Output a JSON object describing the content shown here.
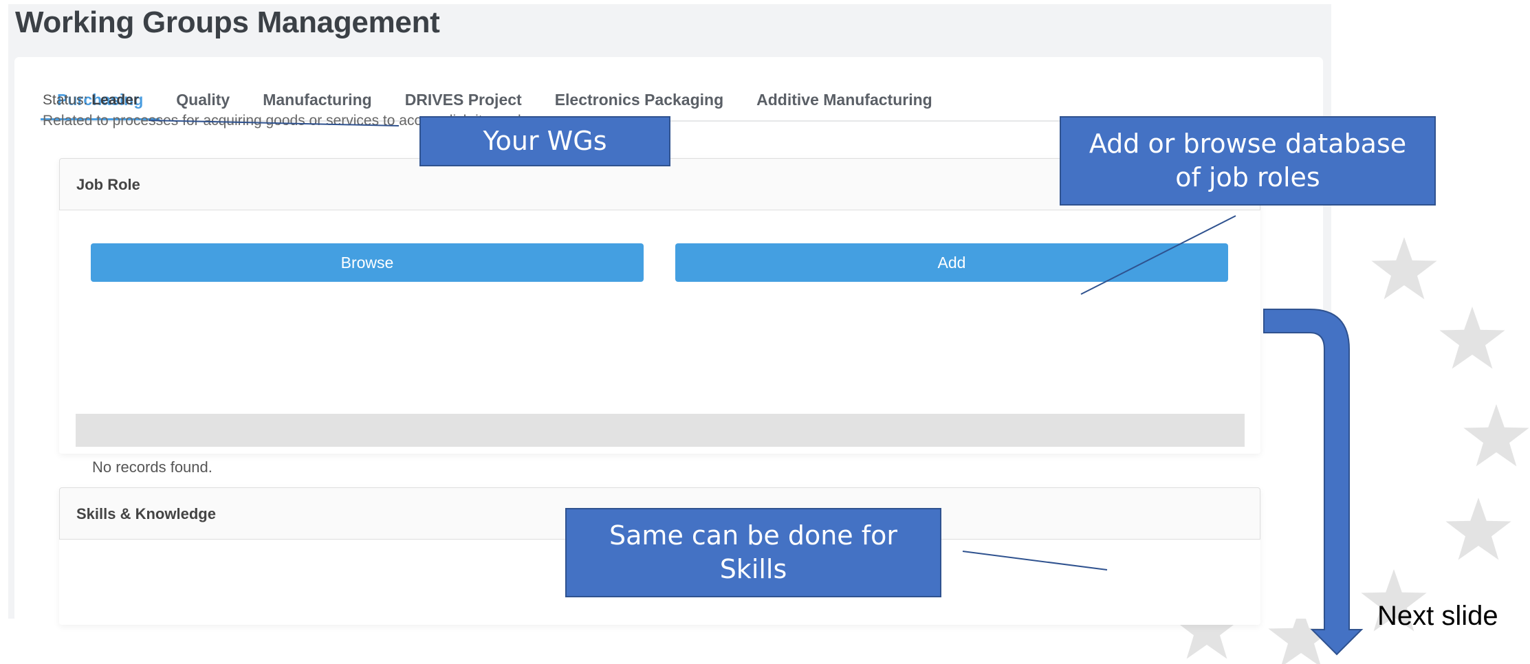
{
  "page": {
    "title": "Working Groups Management"
  },
  "tabs": [
    {
      "label": "Purchasing"
    },
    {
      "label": "Quality"
    },
    {
      "label": "Manufacturing"
    },
    {
      "label": "DRIVES Project"
    },
    {
      "label": "Electronics Packaging"
    },
    {
      "label": "Additive Manufacturing"
    }
  ],
  "group": {
    "status_label": "Status:",
    "status_value": "Leader",
    "description": "Related to processes for acquiring goods or services to accomplish its goals."
  },
  "job_role": {
    "title": "Job Role",
    "browse_label": "Browse",
    "add_label": "Add",
    "empty_text": "No records found."
  },
  "skills": {
    "title": "Skills & Knowledge"
  },
  "annotations": {
    "wgs": "Your WGs",
    "add_browse_line1": "Add or browse database",
    "add_browse_line2": "of job roles",
    "skills_line1": "Same can be done for",
    "skills_line2": "Skills",
    "next_slide": "Next slide"
  },
  "colors": {
    "accent": "#449fe1",
    "callout": "#4472c4",
    "arrow": "#4472c4",
    "star": "#e3e3e3"
  },
  "icons": {
    "decoration": "star-icon",
    "arrow": "down-arrow-icon"
  }
}
